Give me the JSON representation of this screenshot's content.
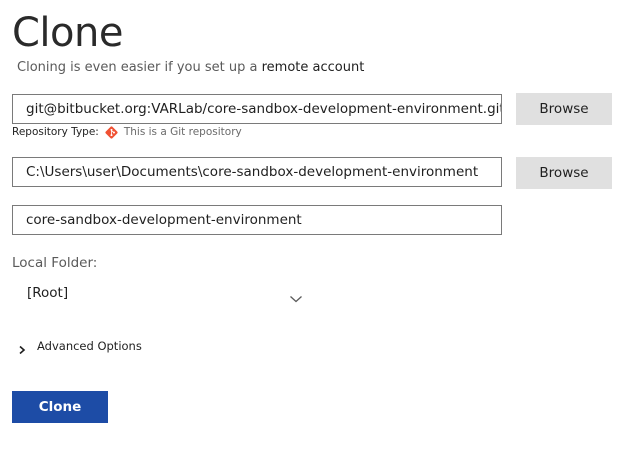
{
  "header": {
    "title": "Clone",
    "subtitle_text": "Cloning is even easier if you set up a",
    "subtitle_link": "remote account"
  },
  "repository": {
    "url_value": "git@bitbucket.org:VARLab/core-sandbox-development-environment.git",
    "browse_label": "Browse",
    "type_label": "Repository Type:",
    "type_value": "This is a Git repository",
    "type_icon": "git-icon"
  },
  "destination": {
    "path_value": "C:\\Users\\user\\Documents\\core-sandbox-development-environment",
    "browse_label": "Browse"
  },
  "name": {
    "value": "core-sandbox-development-environment"
  },
  "local_folder": {
    "label": "Local Folder:",
    "selected": "[Root]"
  },
  "advanced": {
    "label": "Advanced Options"
  },
  "actions": {
    "clone_label": "Clone"
  },
  "colors": {
    "primary_button": "#1d4ca6",
    "secondary_button": "#e0e0e0",
    "git_icon": "#f05133"
  }
}
